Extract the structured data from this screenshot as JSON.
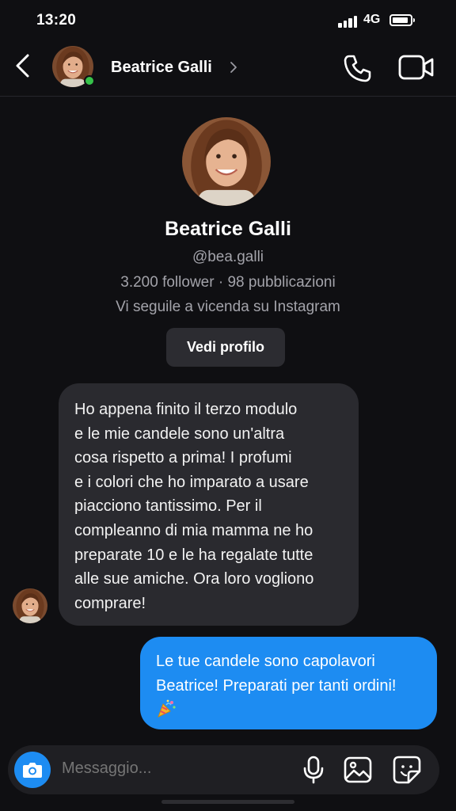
{
  "status_bar": {
    "time": "13:20",
    "network": "4G"
  },
  "header": {
    "name": "Beatrice Galli",
    "online": true,
    "icons": [
      "back-icon",
      "chevron-right-icon",
      "phone-icon",
      "video-camera-icon"
    ]
  },
  "profile": {
    "name": "Beatrice Galli",
    "handle": "@bea.galli",
    "stats": "3.200 follower · 98 pubblicazioni",
    "mutual": "Vi seguile a vicenda su Instagram",
    "view_profile_label": "Vedi profilo"
  },
  "messages": [
    {
      "direction": "incoming",
      "lines": [
        "Ho appena finito il terzo modulo",
        "e le mie candele sono un'altra",
        "cosa rispetto a prima! I profumi",
        "e i colori che ho imparato a usare",
        "piacciono tantissimo. Per il",
        "compleanno di mia mamma ne ho",
        "preparate 10 e le ha regalate tutte",
        "alle sue amiche. Ora loro vogliono",
        "comprare!"
      ]
    },
    {
      "direction": "outgoing",
      "lines": [
        "Le tue candele sono capolavori",
        "Beatrice! Preparati per tanti ordini!"
      ],
      "emoji": "party-popper"
    }
  ],
  "composer": {
    "placeholder": "Messaggio...",
    "icons": [
      "camera-icon",
      "microphone-icon",
      "gallery-icon",
      "sticker-icon"
    ]
  },
  "colors": {
    "background": "#0f0f12",
    "incoming_bubble": "#2a2a2f",
    "outgoing_bubble": "#1d8cf2",
    "online": "#36c24a",
    "secondary_text": "#a3a3aa"
  }
}
